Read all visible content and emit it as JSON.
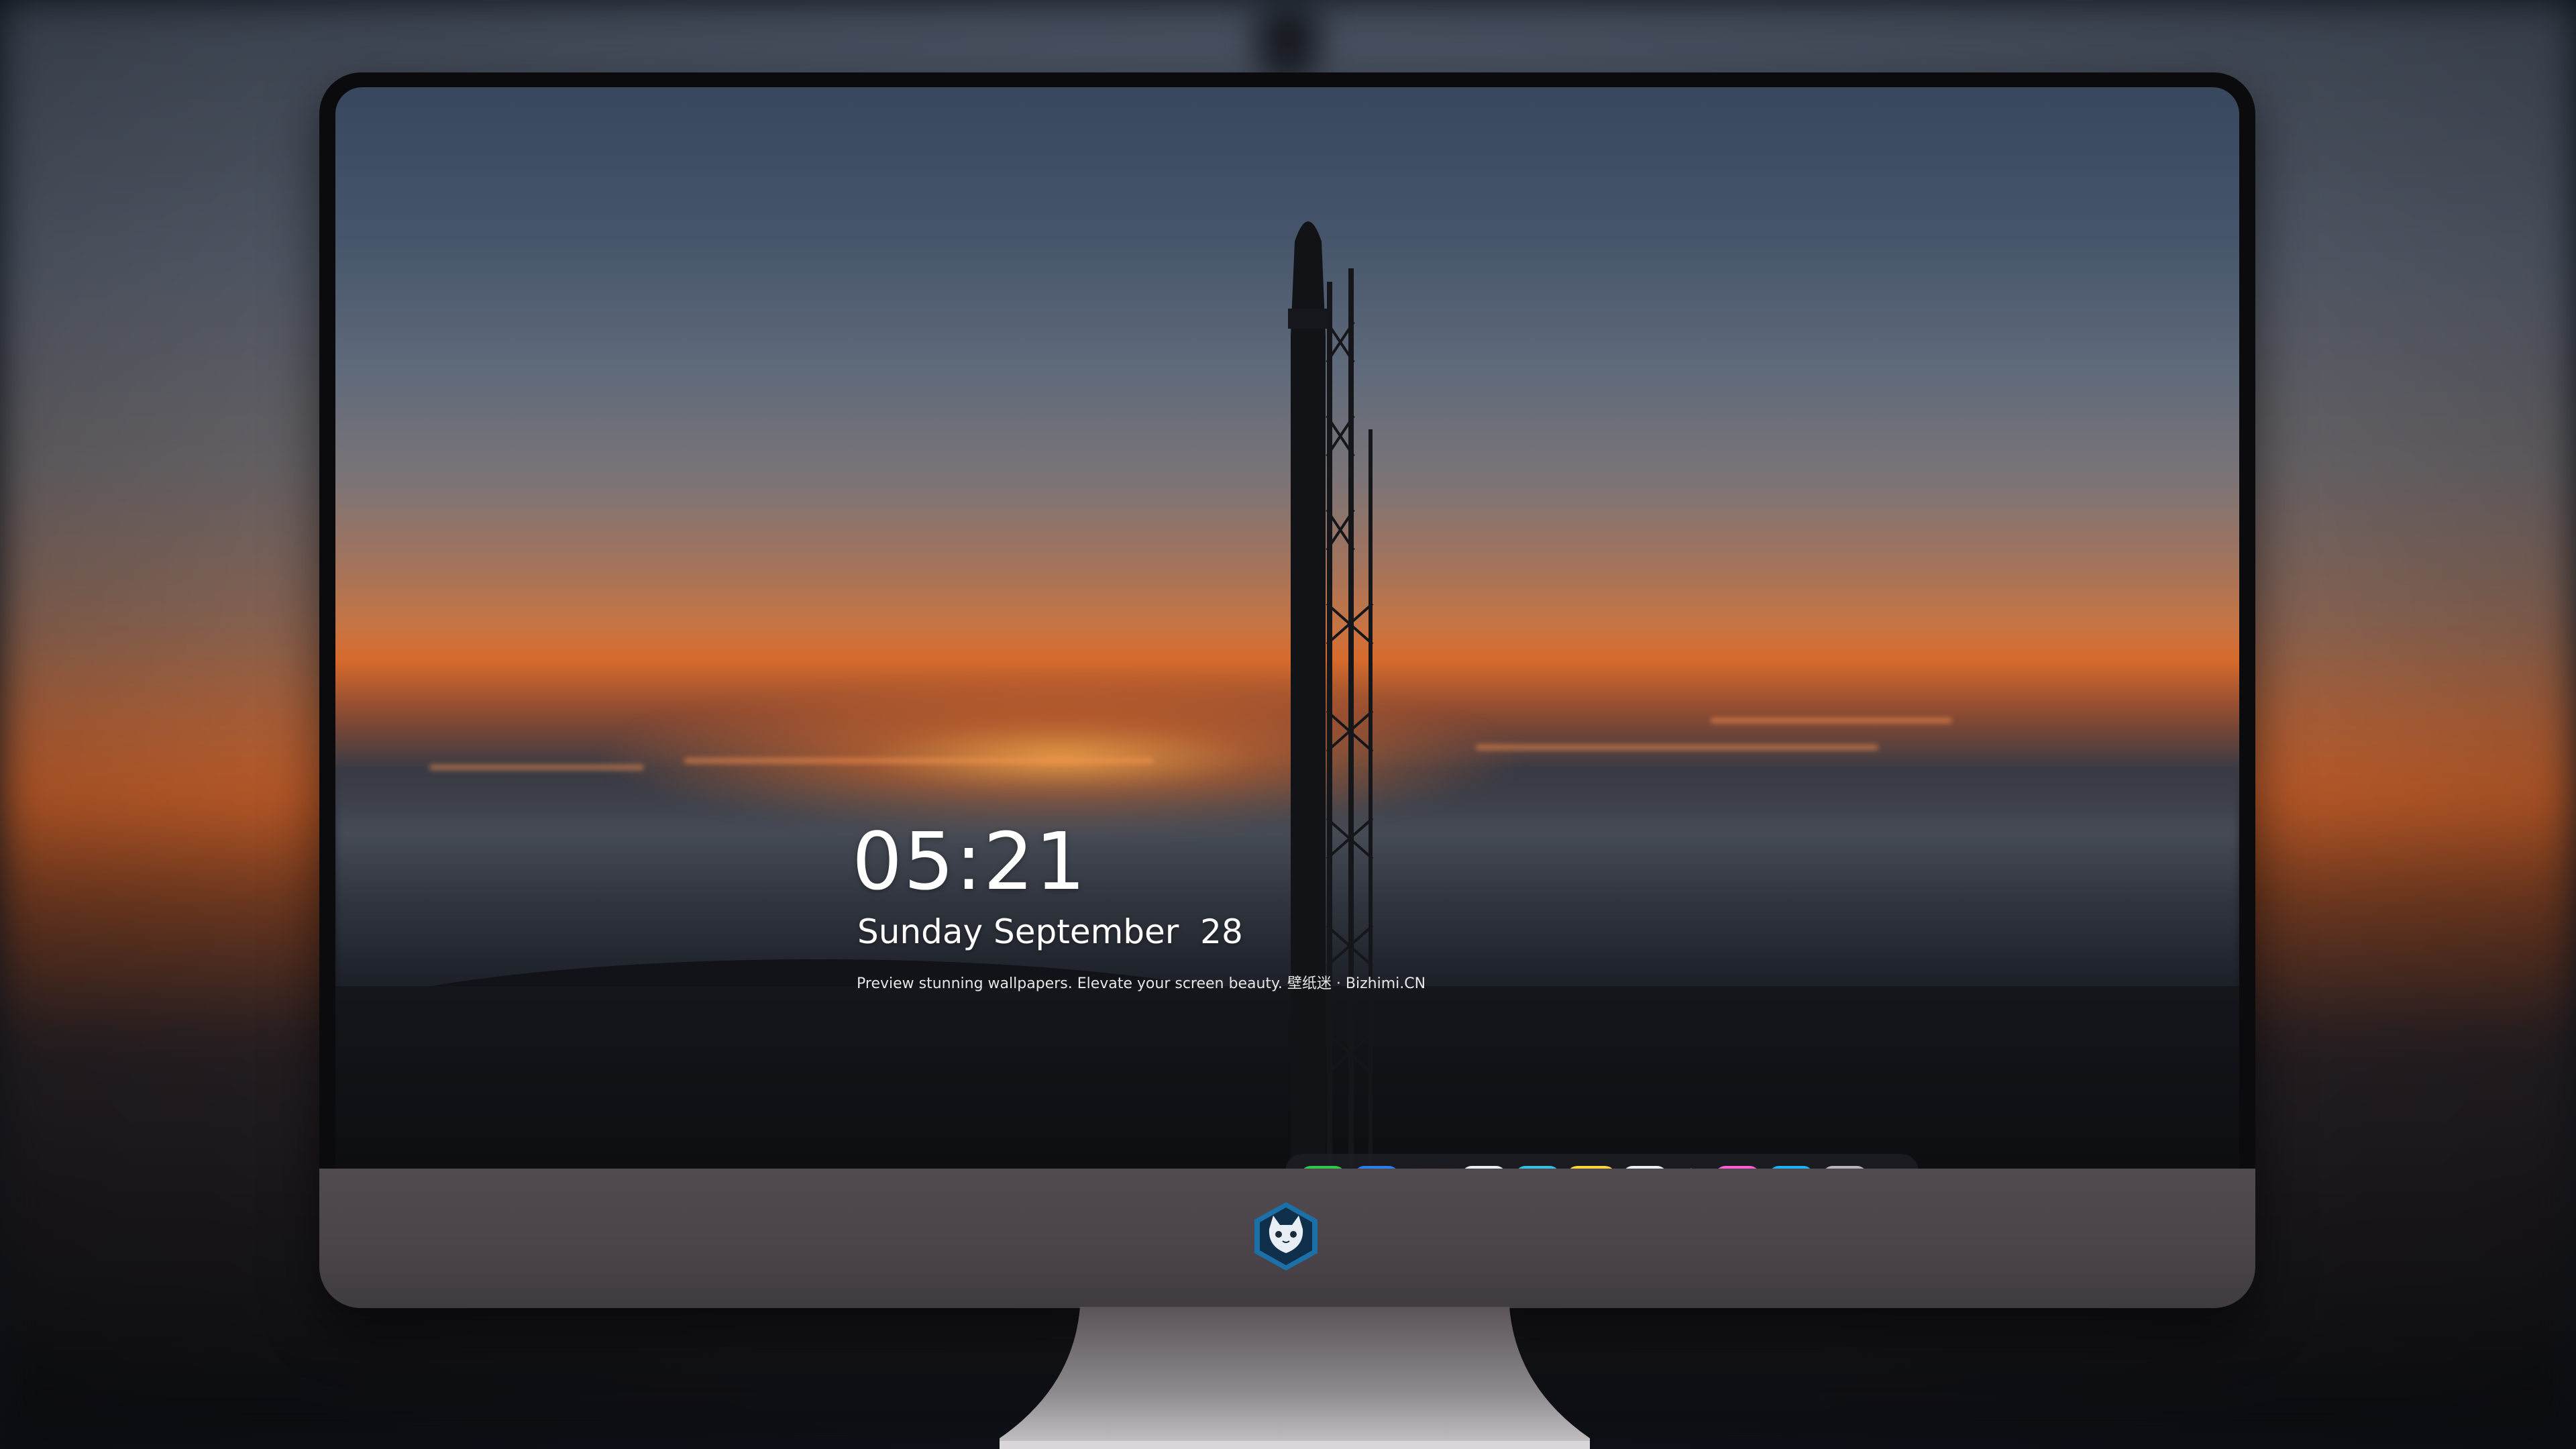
{
  "lock_screen": {
    "time": "05:21",
    "date": "Sunday September  28",
    "tagline": "Preview stunning wallpapers. Elevate your screen beauty. 壁纸迷 · Bizhimi.CN"
  },
  "dock": {
    "apps": [
      {
        "name": "messages-icon",
        "color": "#31c84b"
      },
      {
        "name": "weather-icon",
        "color": "#2f8ff0"
      },
      {
        "name": "clock-icon",
        "color": "#1b1b1b"
      },
      {
        "name": "preview-icon",
        "color": "#4c8ed8"
      },
      {
        "name": "clapper-icon",
        "color": "#39c0e0"
      },
      {
        "name": "notes-icon",
        "color": "#ffd43c"
      },
      {
        "name": "photo-booth-icon",
        "color": "#e9eef3"
      },
      {
        "name": "music-icon",
        "color": "#e94bd3"
      },
      {
        "name": "app-store-icon",
        "color": "#1e8cf2"
      },
      {
        "name": "camera-icon",
        "color": "#9a9a9a"
      }
    ]
  },
  "brand": {
    "logo": "cat-mascot-logo"
  },
  "colors": {
    "accent": "#d66a2c",
    "monitor_chin": "#4a4449"
  }
}
